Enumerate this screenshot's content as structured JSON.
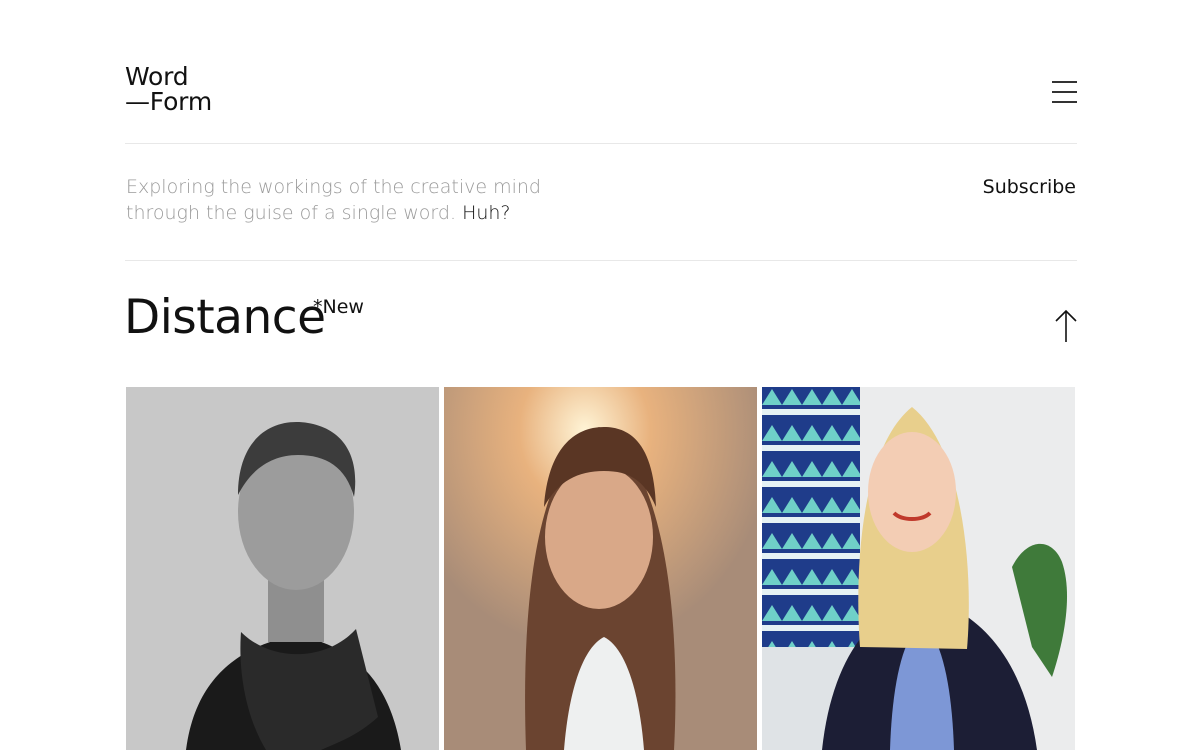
{
  "header": {
    "logo_line1": "Word",
    "logo_line2": "—Form",
    "menu_icon": "hamburger-menu-icon"
  },
  "intro": {
    "text": "Exploring the workings of the creative mind through the guise of a single word.",
    "link": "Huh?",
    "subscribe": "Subscribe"
  },
  "feature": {
    "title": "Distance",
    "badge": "*New",
    "arrow_icon": "arrow-up-icon"
  },
  "gallery": {
    "people": [
      {
        "icon": "portrait-man-icon"
      },
      {
        "icon": "portrait-woman-icon"
      },
      {
        "icon": "portrait-woman-icon"
      }
    ]
  },
  "colors": {
    "text": "#111111",
    "muted": "#9a9a9a",
    "rule": "#e8e8e8"
  }
}
